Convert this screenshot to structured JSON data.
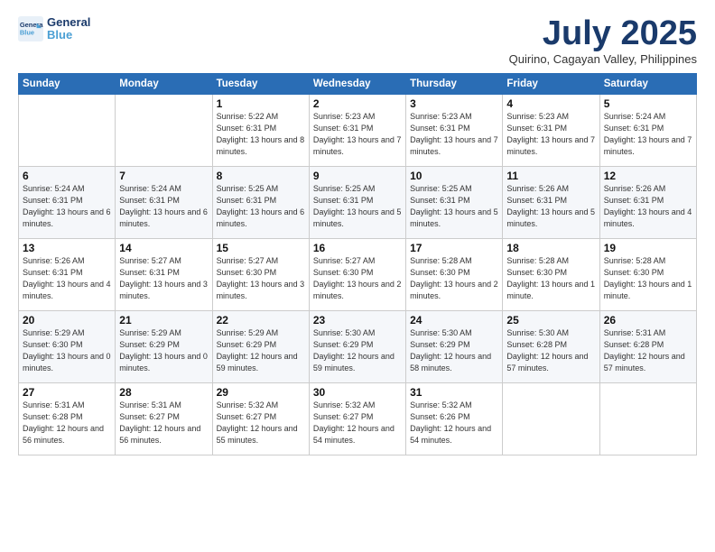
{
  "logo": {
    "line1": "General",
    "line2": "Blue"
  },
  "title": "July 2025",
  "subtitle": "Quirino, Cagayan Valley, Philippines",
  "weekdays": [
    "Sunday",
    "Monday",
    "Tuesday",
    "Wednesday",
    "Thursday",
    "Friday",
    "Saturday"
  ],
  "weeks": [
    [
      {
        "day": "",
        "info": ""
      },
      {
        "day": "",
        "info": ""
      },
      {
        "day": "1",
        "info": "Sunrise: 5:22 AM\nSunset: 6:31 PM\nDaylight: 13 hours and 8 minutes."
      },
      {
        "day": "2",
        "info": "Sunrise: 5:23 AM\nSunset: 6:31 PM\nDaylight: 13 hours and 7 minutes."
      },
      {
        "day": "3",
        "info": "Sunrise: 5:23 AM\nSunset: 6:31 PM\nDaylight: 13 hours and 7 minutes."
      },
      {
        "day": "4",
        "info": "Sunrise: 5:23 AM\nSunset: 6:31 PM\nDaylight: 13 hours and 7 minutes."
      },
      {
        "day": "5",
        "info": "Sunrise: 5:24 AM\nSunset: 6:31 PM\nDaylight: 13 hours and 7 minutes."
      }
    ],
    [
      {
        "day": "6",
        "info": "Sunrise: 5:24 AM\nSunset: 6:31 PM\nDaylight: 13 hours and 6 minutes."
      },
      {
        "day": "7",
        "info": "Sunrise: 5:24 AM\nSunset: 6:31 PM\nDaylight: 13 hours and 6 minutes."
      },
      {
        "day": "8",
        "info": "Sunrise: 5:25 AM\nSunset: 6:31 PM\nDaylight: 13 hours and 6 minutes."
      },
      {
        "day": "9",
        "info": "Sunrise: 5:25 AM\nSunset: 6:31 PM\nDaylight: 13 hours and 5 minutes."
      },
      {
        "day": "10",
        "info": "Sunrise: 5:25 AM\nSunset: 6:31 PM\nDaylight: 13 hours and 5 minutes."
      },
      {
        "day": "11",
        "info": "Sunrise: 5:26 AM\nSunset: 6:31 PM\nDaylight: 13 hours and 5 minutes."
      },
      {
        "day": "12",
        "info": "Sunrise: 5:26 AM\nSunset: 6:31 PM\nDaylight: 13 hours and 4 minutes."
      }
    ],
    [
      {
        "day": "13",
        "info": "Sunrise: 5:26 AM\nSunset: 6:31 PM\nDaylight: 13 hours and 4 minutes."
      },
      {
        "day": "14",
        "info": "Sunrise: 5:27 AM\nSunset: 6:31 PM\nDaylight: 13 hours and 3 minutes."
      },
      {
        "day": "15",
        "info": "Sunrise: 5:27 AM\nSunset: 6:30 PM\nDaylight: 13 hours and 3 minutes."
      },
      {
        "day": "16",
        "info": "Sunrise: 5:27 AM\nSunset: 6:30 PM\nDaylight: 13 hours and 2 minutes."
      },
      {
        "day": "17",
        "info": "Sunrise: 5:28 AM\nSunset: 6:30 PM\nDaylight: 13 hours and 2 minutes."
      },
      {
        "day": "18",
        "info": "Sunrise: 5:28 AM\nSunset: 6:30 PM\nDaylight: 13 hours and 1 minute."
      },
      {
        "day": "19",
        "info": "Sunrise: 5:28 AM\nSunset: 6:30 PM\nDaylight: 13 hours and 1 minute."
      }
    ],
    [
      {
        "day": "20",
        "info": "Sunrise: 5:29 AM\nSunset: 6:30 PM\nDaylight: 13 hours and 0 minutes."
      },
      {
        "day": "21",
        "info": "Sunrise: 5:29 AM\nSunset: 6:29 PM\nDaylight: 13 hours and 0 minutes."
      },
      {
        "day": "22",
        "info": "Sunrise: 5:29 AM\nSunset: 6:29 PM\nDaylight: 12 hours and 59 minutes."
      },
      {
        "day": "23",
        "info": "Sunrise: 5:30 AM\nSunset: 6:29 PM\nDaylight: 12 hours and 59 minutes."
      },
      {
        "day": "24",
        "info": "Sunrise: 5:30 AM\nSunset: 6:29 PM\nDaylight: 12 hours and 58 minutes."
      },
      {
        "day": "25",
        "info": "Sunrise: 5:30 AM\nSunset: 6:28 PM\nDaylight: 12 hours and 57 minutes."
      },
      {
        "day": "26",
        "info": "Sunrise: 5:31 AM\nSunset: 6:28 PM\nDaylight: 12 hours and 57 minutes."
      }
    ],
    [
      {
        "day": "27",
        "info": "Sunrise: 5:31 AM\nSunset: 6:28 PM\nDaylight: 12 hours and 56 minutes."
      },
      {
        "day": "28",
        "info": "Sunrise: 5:31 AM\nSunset: 6:27 PM\nDaylight: 12 hours and 56 minutes."
      },
      {
        "day": "29",
        "info": "Sunrise: 5:32 AM\nSunset: 6:27 PM\nDaylight: 12 hours and 55 minutes."
      },
      {
        "day": "30",
        "info": "Sunrise: 5:32 AM\nSunset: 6:27 PM\nDaylight: 12 hours and 54 minutes."
      },
      {
        "day": "31",
        "info": "Sunrise: 5:32 AM\nSunset: 6:26 PM\nDaylight: 12 hours and 54 minutes."
      },
      {
        "day": "",
        "info": ""
      },
      {
        "day": "",
        "info": ""
      }
    ]
  ]
}
